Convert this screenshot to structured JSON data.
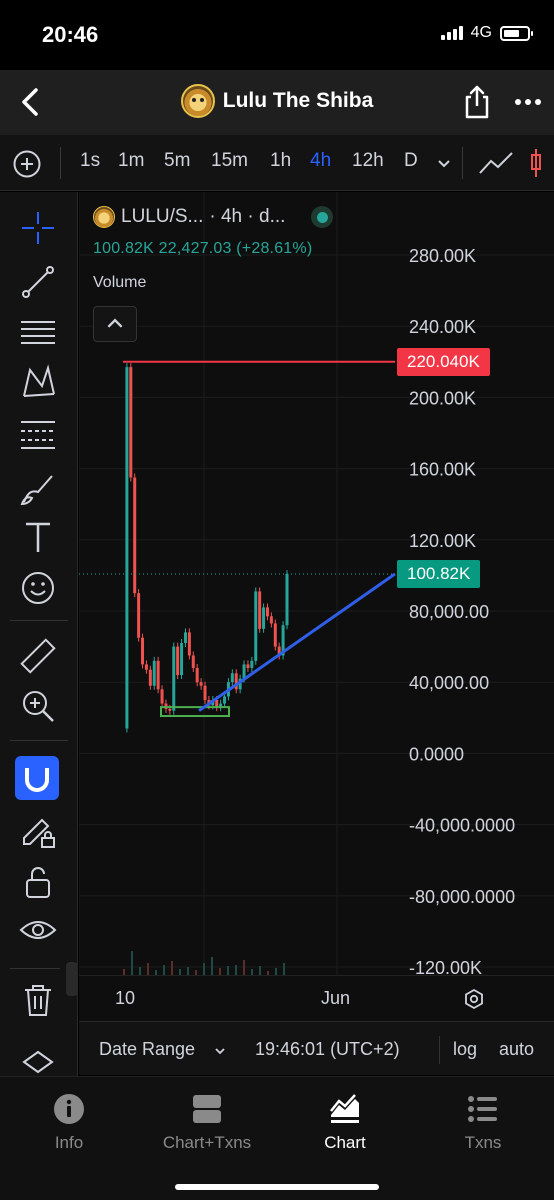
{
  "status_bar": {
    "time": "20:46",
    "network": "4G"
  },
  "header": {
    "title": "Lulu The Shiba"
  },
  "toolbar": {
    "timeframes": [
      "1s",
      "1m",
      "5m",
      "15m",
      "1h",
      "4h",
      "12h",
      "D"
    ],
    "active_timeframe": "4h"
  },
  "legend": {
    "symbol": "LULU/S...",
    "interval": "· 4h · d...",
    "ohlc": "100.82K  22,427.03 (+28.61%)",
    "volume_label": "Volume"
  },
  "price_axis": {
    "labels": [
      "280.00K",
      "240.00K",
      "200.00K",
      "160.00K",
      "120.00K",
      "80,000.00",
      "40,000.00",
      "0.0000",
      "-40,000.0000",
      "-80,000.0000",
      "-120.00K"
    ]
  },
  "price_tags": {
    "resistance": "220.040K",
    "last": "100.82K"
  },
  "time_axis": {
    "labels": [
      "10",
      "Jun"
    ]
  },
  "controls": {
    "date_range": "Date Range",
    "clock": "19:46:01 (UTC+2)",
    "log": "log",
    "auto": "auto"
  },
  "tabs": [
    {
      "label": "Info",
      "icon": "info-icon"
    },
    {
      "label": "Chart+Txns",
      "icon": "split-view-icon"
    },
    {
      "label": "Chart",
      "icon": "chart-icon"
    },
    {
      "label": "Txns",
      "icon": "list-icon"
    }
  ],
  "colors": {
    "up": "#26a69a",
    "down": "#ef5350",
    "accent": "#2962ff",
    "resistance_line": "#f23645",
    "trend_line": "#2f5fe8",
    "support_box": "#4caf50"
  },
  "chart_data": {
    "type": "candlestick",
    "ylim": [
      -120000,
      280000
    ],
    "resistance_level": 220040,
    "last_price": 100820,
    "support_zone": [
      21000,
      26000
    ],
    "price_path": [
      [
        0,
        14000
      ],
      [
        0.5,
        217000
      ],
      [
        1,
        155000
      ],
      [
        1.5,
        90000
      ],
      [
        2,
        65000
      ],
      [
        2.5,
        50000
      ],
      [
        3,
        47000
      ],
      [
        3.5,
        38000
      ],
      [
        4,
        52000
      ],
      [
        4.5,
        36000
      ],
      [
        5,
        28000
      ],
      [
        5.5,
        25000
      ],
      [
        6,
        24000
      ],
      [
        6.5,
        60000
      ],
      [
        7,
        44000
      ],
      [
        7.5,
        62000
      ],
      [
        8,
        68000
      ],
      [
        8.5,
        55000
      ],
      [
        9,
        48000
      ],
      [
        9.5,
        40000
      ],
      [
        10,
        38000
      ],
      [
        10.5,
        30000
      ],
      [
        11,
        27000
      ],
      [
        11.5,
        30000
      ],
      [
        12,
        26000
      ],
      [
        12.5,
        28000
      ],
      [
        13,
        32000
      ],
      [
        13.5,
        40000
      ],
      [
        14,
        45000
      ],
      [
        14.5,
        36000
      ],
      [
        15,
        42000
      ],
      [
        15.5,
        50000
      ],
      [
        16,
        48000
      ],
      [
        16.5,
        52000
      ],
      [
        17,
        91000
      ],
      [
        17.5,
        70000
      ],
      [
        18,
        82000
      ],
      [
        18.5,
        77000
      ],
      [
        19,
        73000
      ],
      [
        19.5,
        60000
      ],
      [
        20,
        55000
      ],
      [
        20.5,
        72000
      ],
      [
        21,
        100820
      ]
    ]
  }
}
